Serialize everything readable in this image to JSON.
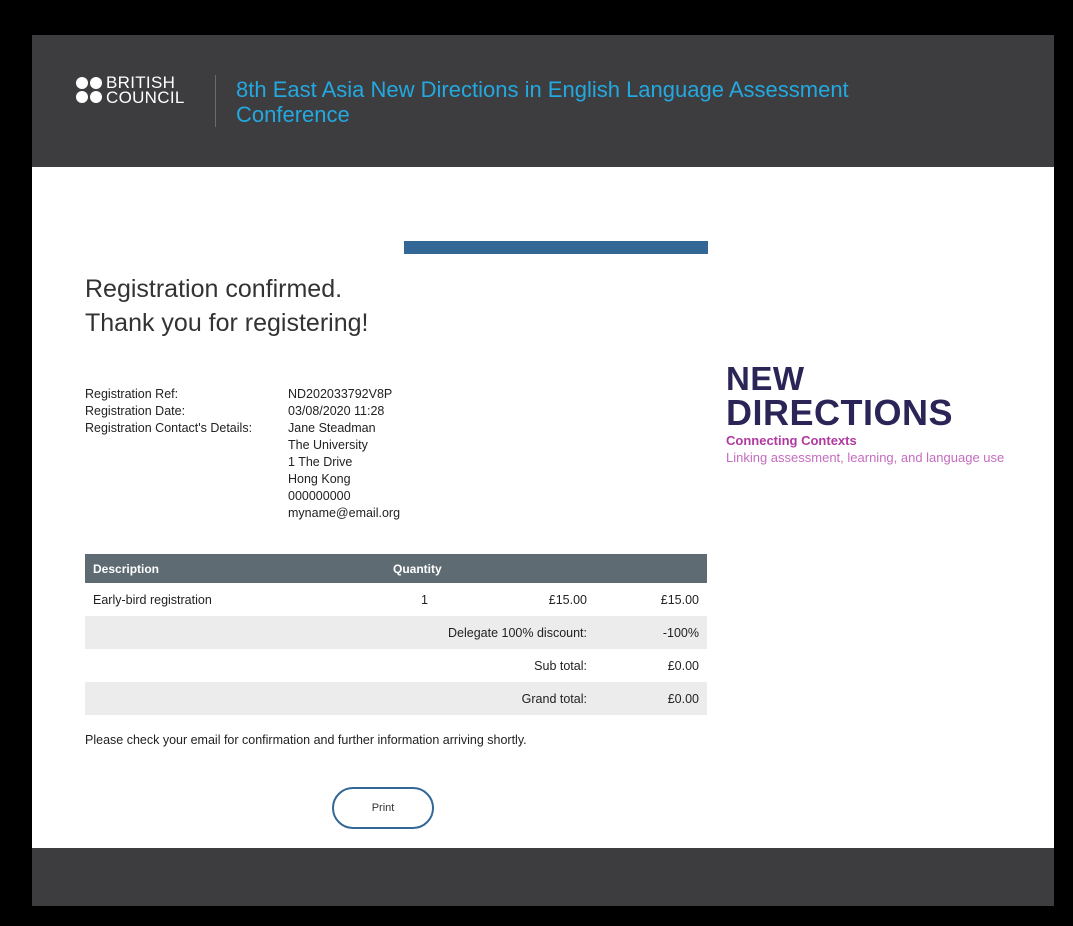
{
  "header": {
    "brand_line1": "BRITISH",
    "brand_line2": "COUNCIL",
    "conference_title": "8th East Asia New Directions in English Language Assessment Conference"
  },
  "confirmation": {
    "line1": "Registration confirmed.",
    "line2": "Thank you for registering!"
  },
  "details": {
    "ref_label": "Registration Ref:",
    "ref_value": "ND202033792V8P",
    "date_label": "Registration Date:",
    "date_value": "03/08/2020 11:28",
    "contact_label": "Registration Contact's Details:",
    "contact_lines": [
      "Jane Steadman",
      "The University",
      "1 The Drive",
      "Hong Kong",
      "000000000",
      "myname@email.org"
    ]
  },
  "order": {
    "headers": [
      "Description",
      "Quantity",
      "",
      ""
    ],
    "item": {
      "description": "Early-bird registration",
      "quantity": "1",
      "price": "£15.00",
      "total": "£15.00"
    },
    "discount_label": "Delegate 100% discount:",
    "discount_value": "-100%",
    "subtotal_label": "Sub total:",
    "subtotal_value": "£0.00",
    "grandtotal_label": "Grand total:",
    "grandtotal_value": "£0.00"
  },
  "notice": "Please check your email for confirmation and further information arriving shortly.",
  "print_label": "Print",
  "nd_logo": {
    "line1": "NEW",
    "line2": "DIRECTIONS",
    "sub1": "Connecting Contexts",
    "sub2": "Linking assessment, learning, and language use"
  },
  "colors": {
    "header_bg": "#3d3d3f",
    "title_blue": "#23a8e0",
    "accent_blue": "#336795",
    "table_header": "#5f6b73",
    "nd_navy": "#2a2556",
    "nd_magenta": "#b03aa0"
  }
}
